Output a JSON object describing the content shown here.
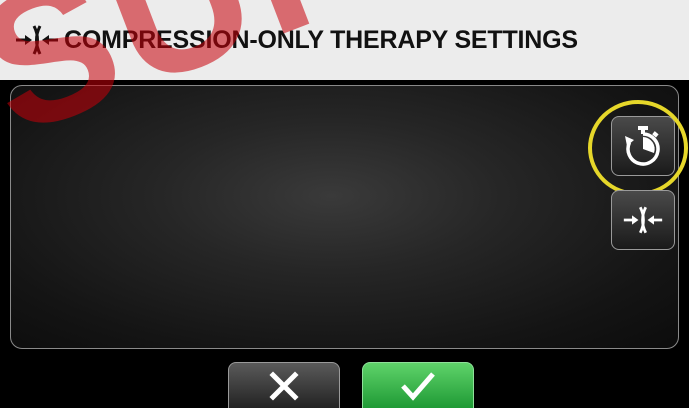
{
  "header": {
    "title": "COMPRESSION-ONLY THERAPY SETTINGS",
    "icon": "compression-icon"
  },
  "watermark": {
    "text": "SUPPLE",
    "color": "#c8000a"
  },
  "side_buttons": [
    {
      "icon": "timer-icon",
      "highlighted": true
    },
    {
      "icon": "compression-icon",
      "highlighted": false
    }
  ],
  "actions": {
    "cancel_icon": "close-icon",
    "confirm_icon": "checkmark-icon",
    "confirm_color": "#2fb045"
  },
  "colors": {
    "header_bg": "#ececec",
    "highlight_ring": "#e6d72a"
  }
}
